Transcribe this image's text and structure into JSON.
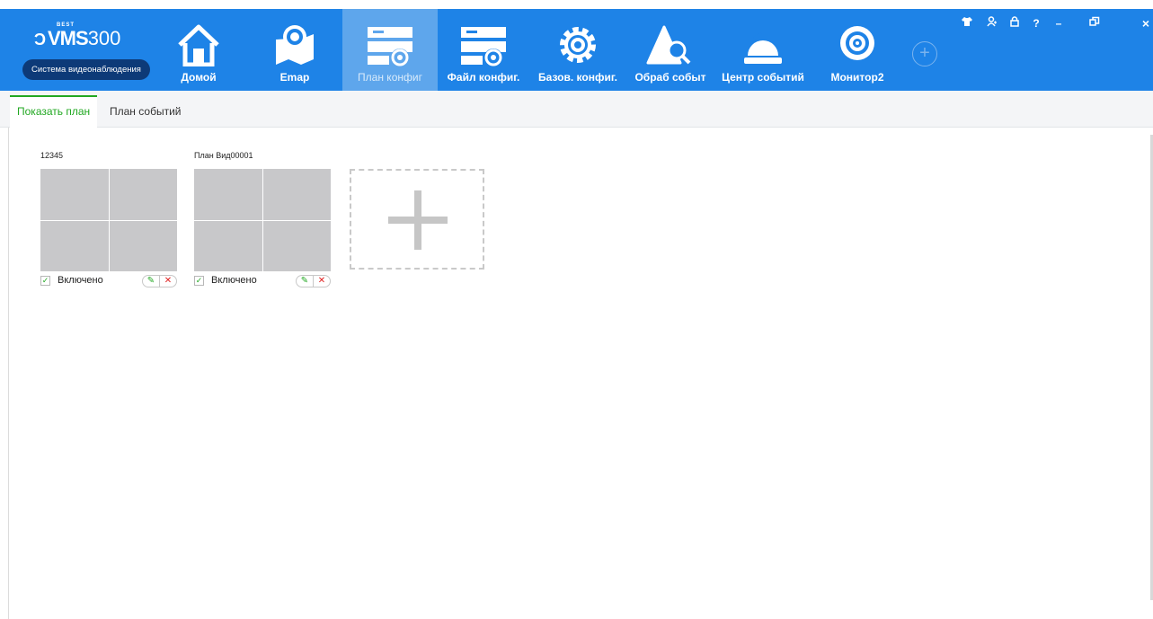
{
  "app": {
    "logo_brand": "VMS",
    "logo_model": "300",
    "logo_super": "BEST",
    "logo_subtitle": "Система видеонаблюдения"
  },
  "nav": {
    "items": [
      {
        "label": "Домой",
        "icon": "home-icon"
      },
      {
        "label": "Emap",
        "icon": "map-pin-icon"
      },
      {
        "label": "План конфиг",
        "icon": "server-gear-icon",
        "active": true
      },
      {
        "label": "Файл конфиг.",
        "icon": "server-gear-icon"
      },
      {
        "label": "Базов. конфиг.",
        "icon": "gear-icon"
      },
      {
        "label": "Обраб событ",
        "icon": "alert-search-icon"
      },
      {
        "label": "Центр событий",
        "icon": "alarm-bell-icon"
      },
      {
        "label": "Монитор2",
        "icon": "monitor-disc-icon"
      }
    ],
    "add_icon": "plus-circle-icon",
    "add_symbol": "+"
  },
  "window_controls": [
    {
      "name": "skin-icon",
      "symbol": "👕"
    },
    {
      "name": "user-icon",
      "symbol": "ℛ"
    },
    {
      "name": "lock-icon",
      "symbol": "🔒"
    },
    {
      "name": "help-icon",
      "symbol": "?"
    },
    {
      "name": "minimize-icon",
      "symbol": "–"
    },
    {
      "name": "restore-icon",
      "symbol": "⧉"
    },
    {
      "name": "close-icon",
      "symbol": "×"
    }
  ],
  "tabs": [
    {
      "label": "Показать план",
      "active": true
    },
    {
      "label": "План событий",
      "active": false
    }
  ],
  "plans": [
    {
      "title": "12345",
      "enabled_label": "Включено",
      "enabled": true,
      "edit_symbol": "✎",
      "delete_symbol": "✕",
      "check_symbol": "✓"
    },
    {
      "title": "План Вид00001",
      "enabled_label": "Включено",
      "enabled": true,
      "edit_symbol": "✎",
      "delete_symbol": "✕",
      "check_symbol": "✓"
    }
  ],
  "colors": {
    "topbar": "#1e83e7",
    "active_nav": "#5ea6ec",
    "active_tab_text": "#22a822",
    "logo_pill": "#0d3a78"
  }
}
